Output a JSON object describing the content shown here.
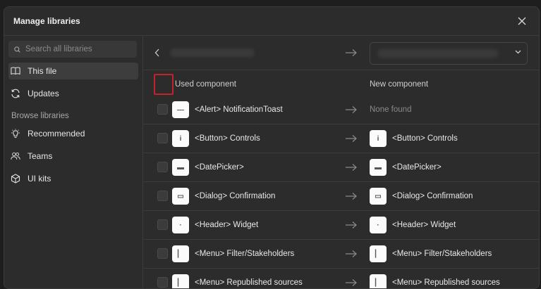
{
  "dialog": {
    "title": "Manage libraries"
  },
  "search": {
    "placeholder": "Search all libraries"
  },
  "sidebar": {
    "items": [
      {
        "label": "This file",
        "icon": "book-icon",
        "active": true
      },
      {
        "label": "Updates",
        "icon": "refresh-icon",
        "active": false
      }
    ],
    "browse_label": "Browse libraries",
    "browse_items": [
      {
        "label": "Recommended",
        "icon": "lightbulb-icon"
      },
      {
        "label": "Teams",
        "icon": "users-icon"
      },
      {
        "label": "UI kits",
        "icon": "cube-icon"
      }
    ]
  },
  "columns": {
    "used": "Used component",
    "new": "New component"
  },
  "rows": [
    {
      "used": "<Alert> NotificationToast",
      "new": "None found",
      "found": false,
      "glyph": "—"
    },
    {
      "used": "<Button> Controls",
      "new": "<Button> Controls",
      "found": true,
      "glyph": "i"
    },
    {
      "used": "<DatePicker>",
      "new": "<DatePicker>",
      "found": true,
      "glyph": "▬"
    },
    {
      "used": "<Dialog> Confirmation",
      "new": "<Dialog> Confirmation",
      "found": true,
      "glyph": "▭"
    },
    {
      "used": "<Header> Widget",
      "new": "<Header> Widget",
      "found": true,
      "glyph": "·"
    },
    {
      "used": "<Menu> Filter/Stakeholders",
      "new": "<Menu> Filter/Stakeholders",
      "found": true,
      "glyph": "▏"
    },
    {
      "used": "<Menu> Republished sources",
      "new": "<Menu> Republished sources",
      "found": true,
      "glyph": "▏"
    }
  ],
  "colors": {
    "background": "#2c2c2c",
    "border": "#3c3c3c",
    "highlight": "#c0242b"
  }
}
